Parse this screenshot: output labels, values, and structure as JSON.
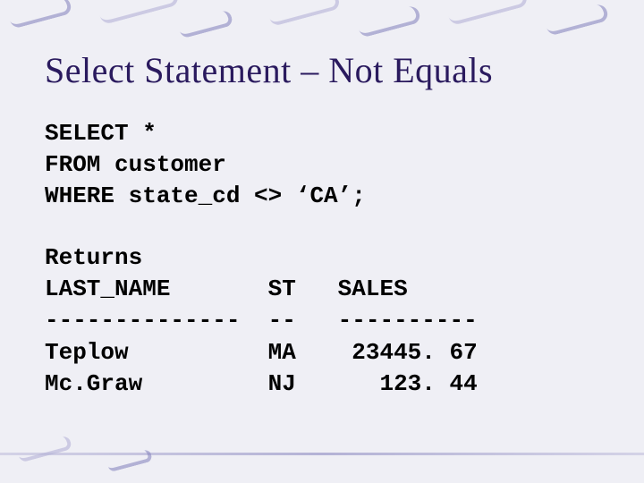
{
  "title": "Select Statement – Not Equals",
  "sql": {
    "line1": "SELECT *",
    "line2": "FROM customer",
    "line3": "WHERE state_cd <> ‘CA’;"
  },
  "result": {
    "heading": "Returns",
    "header": "LAST_NAME       ST   SALES",
    "divider": "--------------  --   ----------",
    "row1": "Teplow          MA    23445. 67",
    "row2": "Mc.Graw         NJ      123. 44"
  }
}
